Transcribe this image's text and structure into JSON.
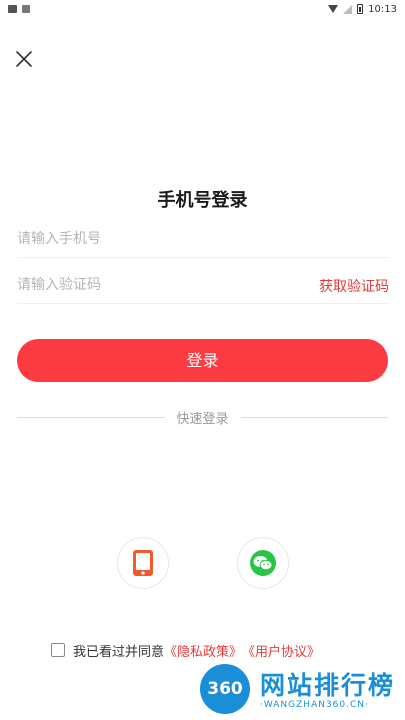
{
  "status_bar": {
    "time": "10:13"
  },
  "page": {
    "title": "手机号登录"
  },
  "form": {
    "phone_placeholder": "请输入手机号",
    "phone_value": "",
    "code_placeholder": "请输入验证码",
    "code_value": "",
    "get_code_label": "获取验证码",
    "login_label": "登录"
  },
  "quick_login": {
    "divider_label": "快速登录",
    "options": [
      {
        "name": "phone",
        "icon": "phone-icon",
        "color": "#f05a28"
      },
      {
        "name": "wechat",
        "icon": "wechat-icon",
        "color": "#28c445"
      }
    ]
  },
  "agreement": {
    "checked": false,
    "prefix": "我已看过并同意",
    "privacy_label": "《隐私政策》",
    "terms_label": "《用户协议》"
  },
  "watermark": {
    "badge": "360",
    "title": "网站排行榜",
    "subtitle": "·WANGZHAN360.CN·"
  },
  "colors": {
    "accent": "#fb3a41",
    "link": "#e63a3a",
    "wechat": "#28c445",
    "phone": "#f05a28"
  }
}
